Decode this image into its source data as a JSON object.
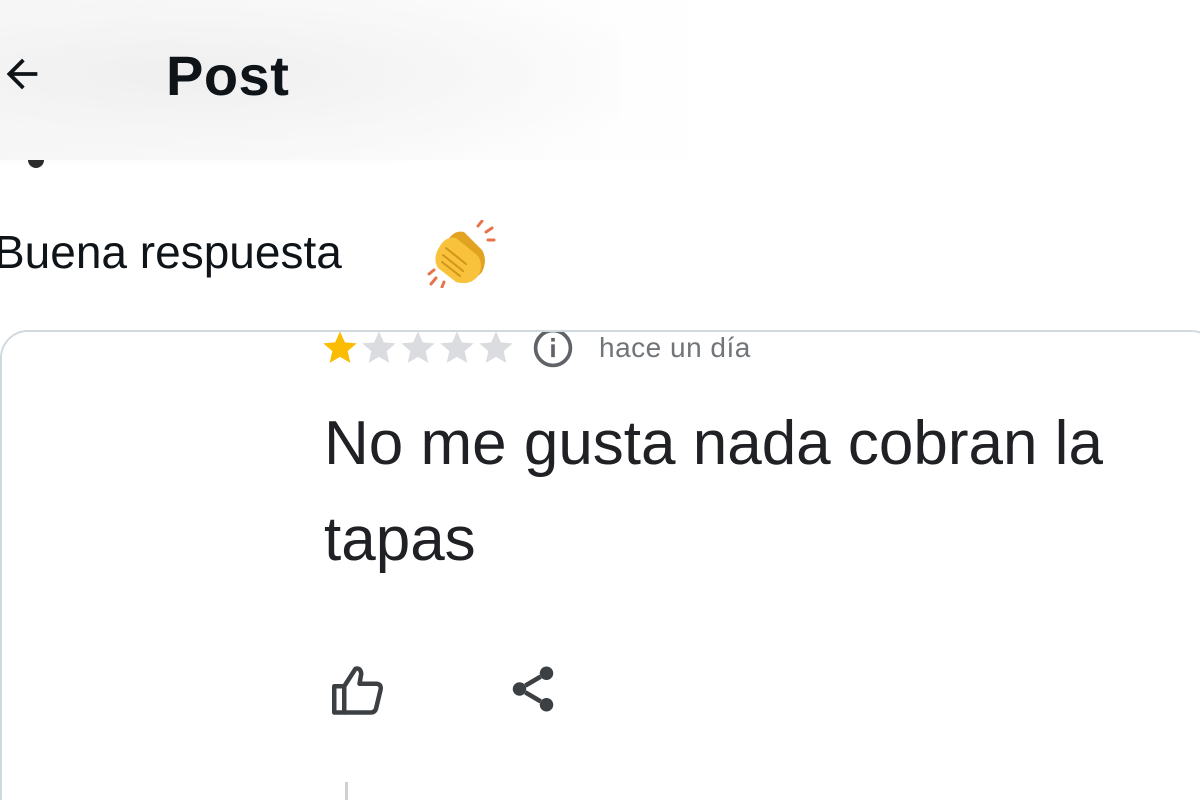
{
  "header": {
    "title": "Post",
    "back_icon": "arrow-left-icon"
  },
  "tweet": {
    "text": "Buena respuesta",
    "emoji": "clapping-hands-icon"
  },
  "review": {
    "rating": 1,
    "max_rating": 5,
    "date": "hace un día",
    "text_line1": "No me gusta nada cobran la",
    "text_line2": "tapas",
    "like_icon": "thumbs-up-icon",
    "share_icon": "share-icon",
    "info_icon": "info-icon"
  },
  "colors": {
    "star_filled": "#fbbc04",
    "star_empty": "#dadce0",
    "text_primary": "#0f1419",
    "review_text": "#202124",
    "muted": "#70757a",
    "card_border": "#cfd9de"
  }
}
